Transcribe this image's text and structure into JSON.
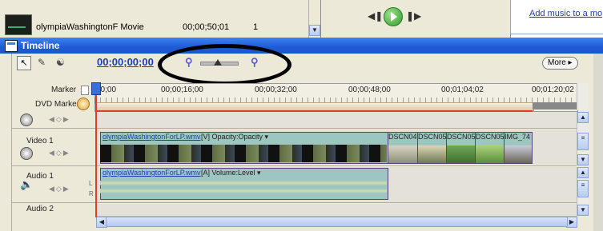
{
  "top": {
    "clip_name": "olympiaWashingtonF Movie",
    "clip_duration": "00;00;50;01",
    "clip_index": "1",
    "help_link": "Add music to a mo"
  },
  "window": {
    "title": "Timeline"
  },
  "toolbar": {
    "timecode": "00;00;00;00",
    "more_label": "More ▸",
    "zoom_level": 0.35
  },
  "ruler": {
    "marker_label": "Marker",
    "dvd_marker_label": "DVD Marker",
    "ticks": [
      "00;00",
      "00;00;16;00",
      "00;00;32;00",
      "00;00;48;00",
      "00;01;04;02",
      "00;01;20;02"
    ]
  },
  "tracks": {
    "video1": {
      "name": "Video 1",
      "clip_name": "olympiaWashingtonForLP.wmv",
      "clip_detail": "[V]  Opacity:Opacity ▾",
      "stills": [
        "DSCN04",
        "DSCN05",
        "DSCN05",
        "DSCN05",
        "IMG_74"
      ]
    },
    "audio1": {
      "name": "Audio 1",
      "clip_name": "olympiaWashingtonForLP.wmv",
      "clip_detail": "[A]  Volume:Level ▾",
      "channel_l": "L",
      "channel_r": "R"
    },
    "audio2": {
      "name": "Audio 2"
    }
  },
  "icons": {
    "selection_tool": "arrow-icon",
    "razor_tool": "razor-icon",
    "add_marker": "marker-pin-icon",
    "zoom_out": "magnifier-minus-icon",
    "zoom_in": "magnifier-plus-icon"
  },
  "colors": {
    "title_bar": "#1e5bd6",
    "playhead": "#e03c2c",
    "clip": "#9dc6c0",
    "timecode": "#1b3fae"
  }
}
